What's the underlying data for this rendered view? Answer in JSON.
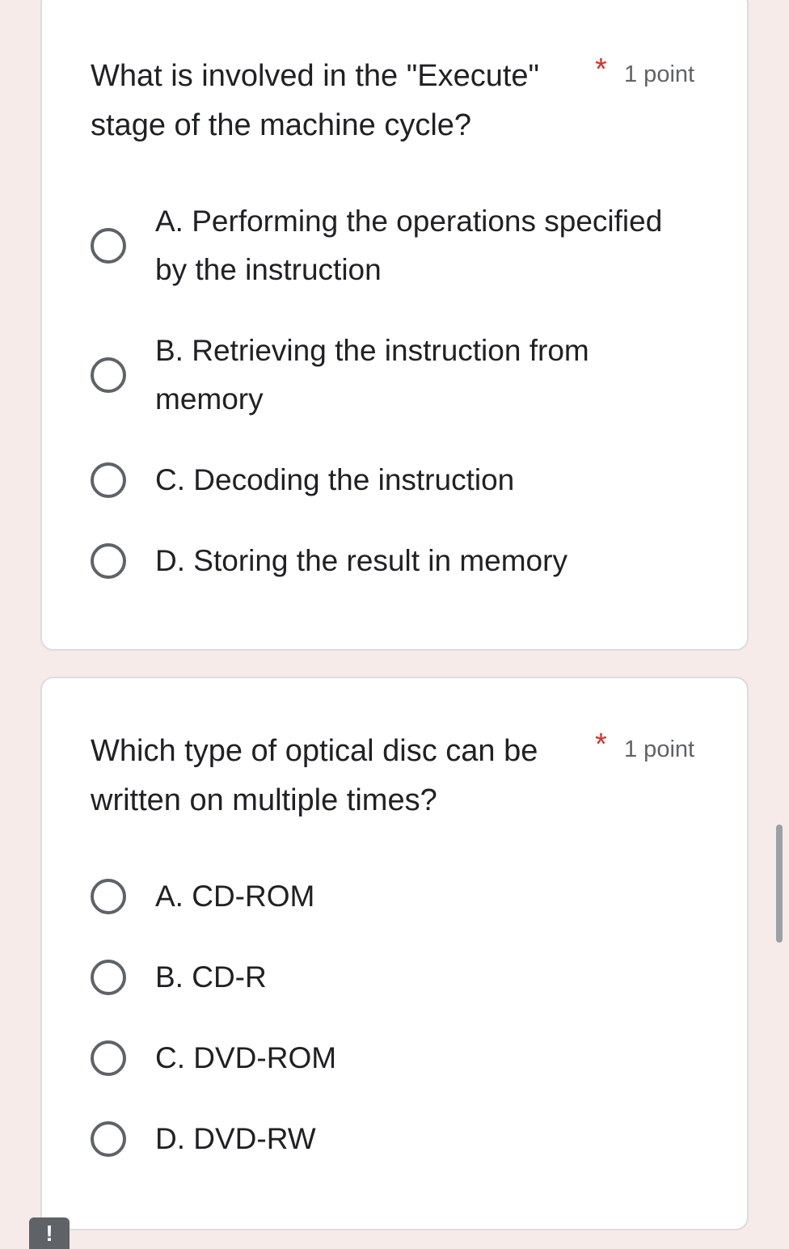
{
  "colors": {
    "page_background": "#f6ebe8",
    "card_background": "#ffffff",
    "required_asterisk": "#d93025",
    "radio_border": "#5f6368"
  },
  "questions": [
    {
      "text": "What is involved in the \"Execute\" stage of the machine cycle?",
      "required_marker": "*",
      "points": "1 point",
      "options": [
        {
          "label": "A. Performing the operations specified by the instruction",
          "selected": false
        },
        {
          "label": "B. Retrieving the instruction from memory",
          "selected": false
        },
        {
          "label": "C. Decoding the instruction",
          "selected": false
        },
        {
          "label": "D. Storing the result in memory",
          "selected": false
        }
      ]
    },
    {
      "text": "Which type of optical disc can be written on multiple times?",
      "required_marker": "*",
      "points": "1 point",
      "options": [
        {
          "label": "A. CD-ROM",
          "selected": false
        },
        {
          "label": "B. CD-R",
          "selected": false
        },
        {
          "label": "C. DVD-ROM",
          "selected": false
        },
        {
          "label": "D. DVD-RW",
          "selected": false
        }
      ]
    }
  ],
  "alert_badge": {
    "icon": "exclamation-icon",
    "glyph": "!"
  }
}
